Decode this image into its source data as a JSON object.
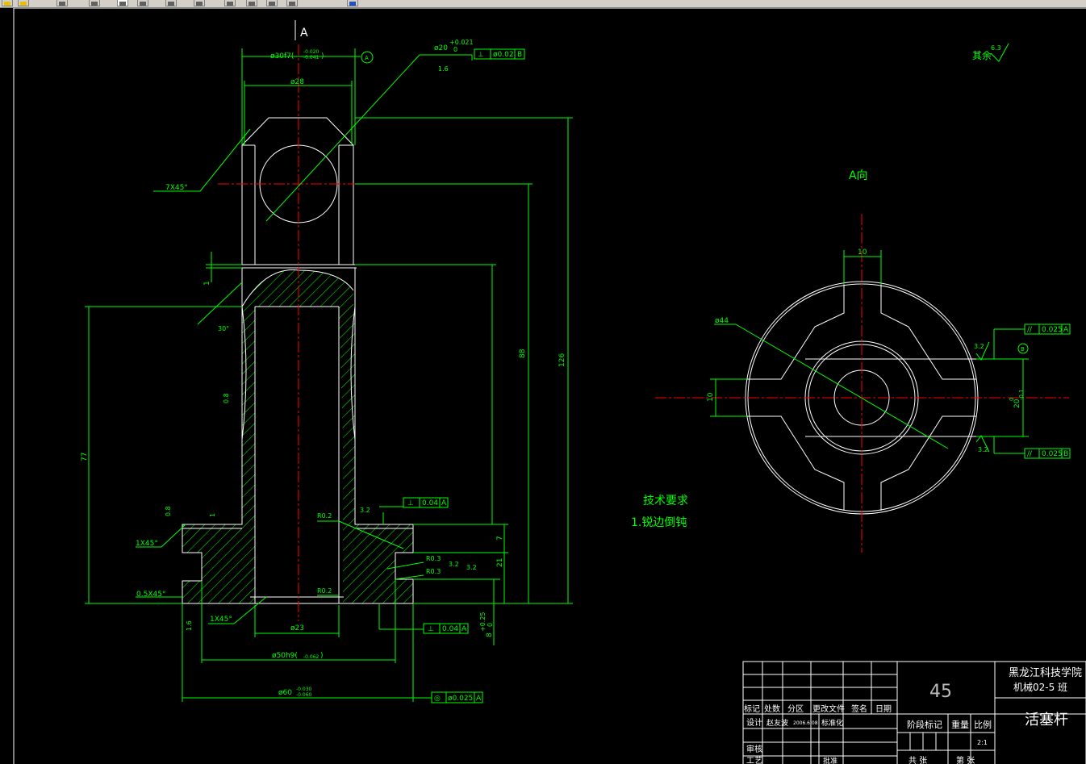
{
  "toolbar": {
    "buttons": [
      "new-icon",
      "open-icon",
      "print-icon",
      "zoom-realtime-icon",
      "zoom-window-icon",
      "zoom-previous-icon",
      "pan-icon",
      "properties-icon",
      "layer-icon",
      "match-icon",
      "designcenter-icon",
      "toolpalette-icon",
      "help-icon"
    ],
    "active_index": 4
  },
  "drawing": {
    "dims": {
      "top_fit": "ø30f7(",
      "top_fit_upper": "-0.020",
      "top_fit_lower": "-0.041",
      "top_fit_close": ")",
      "bore": "ø28",
      "hole_tol": "ø20",
      "hole_upper": "+0.021",
      "hole_lower": "0",
      "hole_rough": "1.6",
      "chamfer_7": "7X45°",
      "angle_30": "30°",
      "dim_1": "1",
      "dim_88": "88",
      "dim_126": "126",
      "dim_77": "77",
      "dim_7": "7",
      "dim_21": "21",
      "rough_08": "0.8",
      "rough_08b": "0.8",
      "rough_32": "3.2",
      "rough_32b": "3.2",
      "rough_32c": "3.2",
      "rough_16": "1.6",
      "r02_top": "R0.2",
      "r03_a": "R0.3",
      "r03_b": "R0.3",
      "r02_bot": "R0.2",
      "chamfer_1x45_top": "1X45°",
      "chamfer_05": "0.5X45°",
      "chamfer_1x45_bot": "1X45°",
      "dim_1_flange": "1",
      "dia_23": "ø23",
      "dia_50": "ø50h9(",
      "dia_50_tol": "-0.062",
      "dia_50_close": ")",
      "dia_60": "ø60",
      "dia_60_upper": "-0.030",
      "dia_60_lower": "-0.060",
      "dim_8": "8",
      "dim_8_upper": "+0.25",
      "dim_8_lower": "0",
      "datum_a_top": "A",
      "view_arrow_label": "A",
      "dia_44": "ø44",
      "dim_10_top": "10",
      "dim_10_left": "10",
      "dim_20": "20",
      "dim_20_upper": "0",
      "dim_20_lower": "-0.1",
      "rough_32_right_top": "3.2",
      "rough_32_right_bot": "3.2",
      "datum_b": "B",
      "view_a": "A向",
      "rest_label": "其余",
      "rest_rough": "6.3"
    },
    "fcf": {
      "hole_perp": [
        "⊥",
        "ø0.02",
        "B"
      ],
      "flange_perp_top": [
        "⊥",
        "0.04",
        "A"
      ],
      "flange_perp_bot": [
        "⊥",
        "0.04",
        "A"
      ],
      "coax_60": [
        "◎",
        "ø0.025",
        "A"
      ],
      "par_top": [
        "//",
        "0.025",
        "A"
      ],
      "par_bot": [
        "//",
        "0.025",
        "B"
      ]
    },
    "notes": {
      "title": "技术要求",
      "line1": "1.锐边倒钝"
    }
  },
  "title_block": {
    "school": "黑龙江科技学院",
    "class": "机械02-5 班",
    "material": "45",
    "part_name": "活塞杆",
    "row_labels": [
      "标记",
      "处数",
      "分区",
      "更改文件",
      "签名",
      "日期"
    ],
    "design_label": "设计",
    "designer": "赵友波",
    "date": "2006.6.08",
    "std_label": "标准化",
    "review_label": "审核",
    "process_label": "工艺",
    "approve_label": "批准",
    "stage_label": "阶段标记",
    "weight_label": "重量",
    "scale_label": "比例",
    "scale": "2:1",
    "sheets_label": "共   张",
    "sheet_label": "第   张"
  }
}
